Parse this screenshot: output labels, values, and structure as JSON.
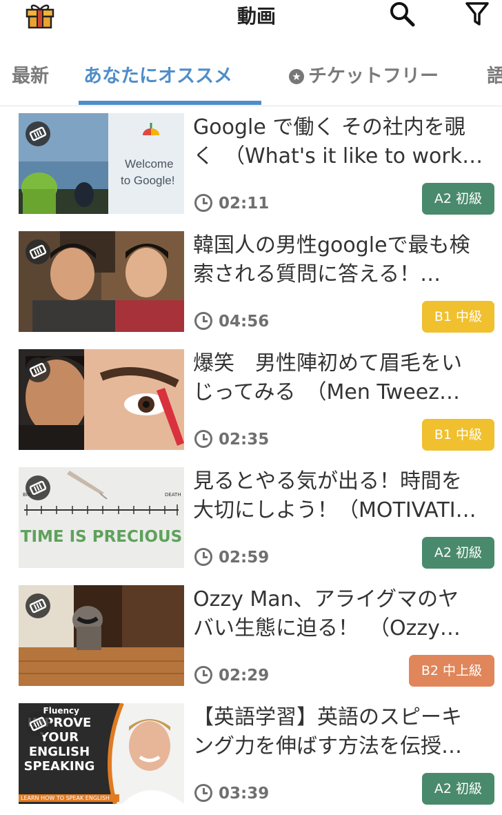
{
  "header": {
    "title": "動画",
    "icons": [
      "gift-icon",
      "search-icon",
      "filter-icon"
    ]
  },
  "tabs": [
    {
      "label": "最新"
    },
    {
      "label": "あなたにオススメ",
      "active": true
    },
    {
      "label": "チケットフリー"
    },
    {
      "label": "語"
    }
  ],
  "videos": [
    {
      "title_line1": "Google で働く その社内を覗",
      "title_line2": "く　（What's it like to work…",
      "duration": "02:11",
      "level": "A2 初級",
      "level_color": "#4a8a6c",
      "thumb_text": [
        "Welcome",
        "to Google!"
      ]
    },
    {
      "title_line1": "韓国人の男性googleで最も検",
      "title_line2": "索される質問に答える！…",
      "duration": "04:56",
      "level": "B1 中級",
      "level_color": "#f0c02e"
    },
    {
      "title_line1": "爆笑　男性陣初めて眉毛をい",
      "title_line2": "じってみる　（Men Tweez…",
      "duration": "02:35",
      "level": "B1 中級",
      "level_color": "#f0c02e"
    },
    {
      "title_line1": "見るとやる気が出る！時間を",
      "title_line2": "大切にしよう！（MOTIVATI…",
      "duration": "02:59",
      "level": "A2 初級",
      "level_color": "#4a8a6c",
      "thumb_text": [
        "TIME IS PRECIOUS",
        "BIRTH",
        "DEATH"
      ]
    },
    {
      "title_line1": "Ozzy Man、アライグマのヤ",
      "title_line2": "バい生態に迫る！　（Ozzy…",
      "duration": "02:29",
      "level": "B2 中上級",
      "level_color": "#e0865a"
    },
    {
      "title_line1": "【英語学習】英語のスピーキ",
      "title_line2": "ング力を伸ばす方法を伝授…",
      "duration": "03:39",
      "level": "A2 初級",
      "level_color": "#4a8a6c",
      "thumb_text": [
        "Fluency",
        "IMPROVE",
        "YOUR",
        "ENGLISH",
        "SPEAKING",
        "LEARN HOW TO SPEAK ENGLISH"
      ]
    }
  ]
}
